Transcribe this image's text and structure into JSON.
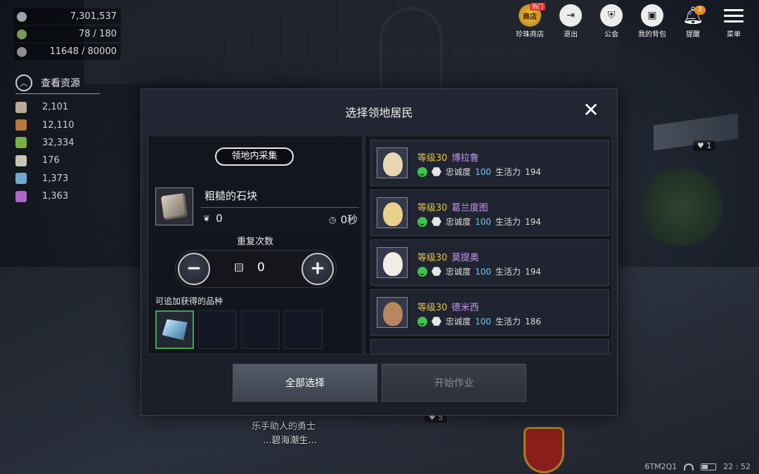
{
  "resources_top": [
    {
      "icon": "silver-coin-icon",
      "value": "7,301,537",
      "color": "#9aa3ab"
    },
    {
      "icon": "energy-icon",
      "value": "78 / 180",
      "color": "#7c9a55"
    },
    {
      "icon": "wheat-icon",
      "value": "11648 / 80000",
      "color": "#8d8d8d"
    }
  ],
  "resource_panel": {
    "title": "查看资源",
    "toggle_icon": "chevron-up-icon",
    "items": [
      {
        "icon": "stone-icon",
        "value": "2,101",
        "color": "#b8ab94"
      },
      {
        "icon": "wood-icon",
        "value": "12,110",
        "color": "#b77a3c"
      },
      {
        "icon": "herb-icon",
        "value": "32,334",
        "color": "#77b144"
      },
      {
        "icon": "flower-icon",
        "value": "176",
        "color": "#c9c5b6"
      },
      {
        "icon": "crystal-icon",
        "value": "1,373",
        "color": "#6fa8d0"
      },
      {
        "icon": "gem-icon",
        "value": "1,363",
        "color": "#b066c6"
      }
    ]
  },
  "top_menu": [
    {
      "name": "shop",
      "label": "珍珠商店",
      "icon": "shop-icon",
      "icon_text": "商店",
      "badge": "热门"
    },
    {
      "name": "exit",
      "label": "退出",
      "icon": "exit-icon"
    },
    {
      "name": "guild",
      "label": "公会",
      "icon": "guild-shield-icon"
    },
    {
      "name": "bag",
      "label": "我的背包",
      "icon": "bag-icon"
    },
    {
      "name": "alert",
      "label": "提醒",
      "icon": "bell-icon",
      "badge": "3"
    },
    {
      "name": "menu",
      "label": "菜单",
      "icon": "hamburger-menu-icon"
    }
  ],
  "dialog": {
    "title": "选择领地居民",
    "category": "领地内采集",
    "item_name": "粗糙的石块",
    "energy_cost": "0",
    "time": "0秒",
    "repeat_label": "重复次数",
    "repeat_count": "0",
    "extra_label": "可追加获得的品种",
    "npcs": [
      {
        "level": "等级30",
        "name": "博拉鲁",
        "loyalty_label": "忠诚度",
        "loyalty": "100",
        "vitality_label": "生活力",
        "vitality": "194",
        "avatar_color": "#e8d7b0"
      },
      {
        "level": "等级30",
        "name": "葛兰度图",
        "loyalty_label": "忠诚度",
        "loyalty": "100",
        "vitality_label": "生活力",
        "vitality": "194",
        "avatar_color": "#e9cf8a"
      },
      {
        "level": "等级30",
        "name": "莫提奥",
        "loyalty_label": "忠诚度",
        "loyalty": "100",
        "vitality_label": "生活力",
        "vitality": "194",
        "avatar_color": "#f1ece4"
      },
      {
        "level": "等级30",
        "name": "德米西",
        "loyalty_label": "忠诚度",
        "loyalty": "100",
        "vitality_label": "生活力",
        "vitality": "186",
        "avatar_color": "#b98660"
      }
    ],
    "select_all_label": "全部选择",
    "start_label": "开始作业"
  },
  "scene": {
    "player_title": "乐手助人的勇士",
    "player_name": "...碧海潮生...",
    "tag_right": "1",
    "tag_bottom": "5",
    "device_name": "6TM2Q1",
    "clock": "22 : 52"
  },
  "colors": {
    "level": "#e7c54a",
    "npc_name": "#c896f2",
    "loyalty": "#6ec8f0",
    "selected_slot": "#3fa45a"
  }
}
